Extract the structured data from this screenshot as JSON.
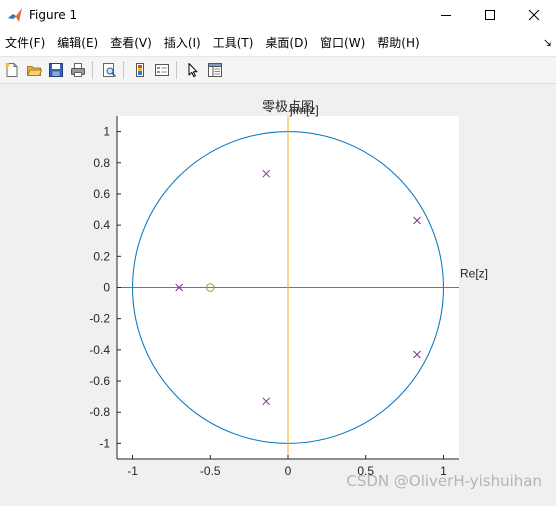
{
  "window": {
    "title": "Figure 1"
  },
  "menu": [
    "文件(F)",
    "编辑(E)",
    "查看(V)",
    "插入(I)",
    "工具(T)",
    "桌面(D)",
    "窗口(W)",
    "帮助(H)"
  ],
  "toolbar": {
    "icons": [
      "new-figure-icon",
      "open-file-icon",
      "save-icon",
      "print-icon",
      "print-preview-icon",
      "insert-colorbar-icon",
      "insert-legend-icon",
      "edit-plot-icon",
      "property-editor-icon"
    ]
  },
  "watermark": "CSDN @OliverH-yishuihan",
  "colors": {
    "unit_circle": "#0072bd",
    "real_axis": "#d95319",
    "imag_axis": "#edb120",
    "poles": "#7e2f8e",
    "zeros": "#77ac30"
  },
  "chart_data": {
    "type": "scatter",
    "title": "零极点图",
    "xlabel": "Re[z]",
    "ylabel": "jIm[z]",
    "xlim": [
      -1.1,
      1.1
    ],
    "ylim": [
      -1.1,
      1.1
    ],
    "xticks": [
      -1,
      -0.5,
      0,
      0.5,
      1
    ],
    "yticks": [
      1,
      0.8,
      0.6,
      0.4,
      0.2,
      0,
      -0.2,
      -0.4,
      -0.6,
      -0.8,
      -1
    ],
    "xtick_labels": [
      "-1",
      "-0.5",
      "0",
      "0.5",
      "1"
    ],
    "ytick_labels": [
      "1",
      "0.8",
      "0.6",
      "0.4",
      "0.2",
      "0",
      "-0.2",
      "-0.4",
      "-0.6",
      "-0.8",
      "-1"
    ],
    "grid": false,
    "unit_circle": {
      "radius": 1
    },
    "poles": [
      {
        "x": -0.7,
        "y": 0
      },
      {
        "x": -0.14,
        "y": 0.73
      },
      {
        "x": -0.14,
        "y": -0.73
      },
      {
        "x": 0.83,
        "y": 0.43
      },
      {
        "x": 0.83,
        "y": -0.43
      }
    ],
    "zeros": [
      {
        "x": -0.5,
        "y": 0
      }
    ]
  }
}
